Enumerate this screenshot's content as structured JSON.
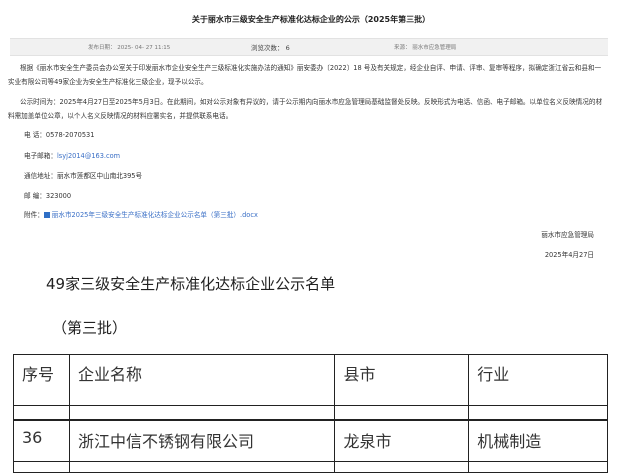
{
  "header": {
    "title": "关于丽水市三级安全生产标准化达标企业的公示（2025年第三批）"
  },
  "meta": {
    "published": "发布日期： 2025- 04- 27 11:15",
    "views_label": "浏览次数：",
    "views_count": "6",
    "source": "来源：  丽水市应急管理局"
  },
  "body": {
    "para1": "根据《丽水市安全生产委员会办公室关于印发丽水市企业安全生产三级标准化实施办法的通知》丽安委办〔2022〕18 号及有关规定，经企业自评、申请、评审、复审等程序，拟确定浙江省云和县和一实业有限公司等49家企业为安全生产标准化三级企业，现予以公示。",
    "para2": "公示时间为：2025年4月27日至2025年5月3日。在此期间，如对公示对象有异议的，请于公示期内向丽水市应急管理局基础监督处反映。反映形式为电话、信函、电子邮箱。以单位名义反映情况的材料需加盖单位公章，以个人名义反映情况的材料应署实名，并提供联系电话。",
    "phone_label": "电   话：",
    "phone": "0578-2070531",
    "email_label": "电子邮箱：",
    "email": "lsyj2014@163.com",
    "address_label": "通信地址：",
    "address": "丽水市莲都区中山南北395号",
    "postcode_label": "邮    编：",
    "postcode": "323000",
    "attachment_label": "附件：",
    "attachment": "丽水市2025年三级安全生产标准化达标企业公示名单（第三批）.docx",
    "signature": "丽水市应急管理局",
    "date": "2025年4月27日"
  },
  "list": {
    "title": "49家三级安全生产标准化达标企业公示名单",
    "subtitle": "（第三批）",
    "columns": [
      "序号",
      "企业名称",
      "县市",
      "行业"
    ],
    "rows": [
      [
        "36",
        "浙江中信不锈钢有限公司",
        "龙泉市",
        "机械制造"
      ]
    ]
  }
}
